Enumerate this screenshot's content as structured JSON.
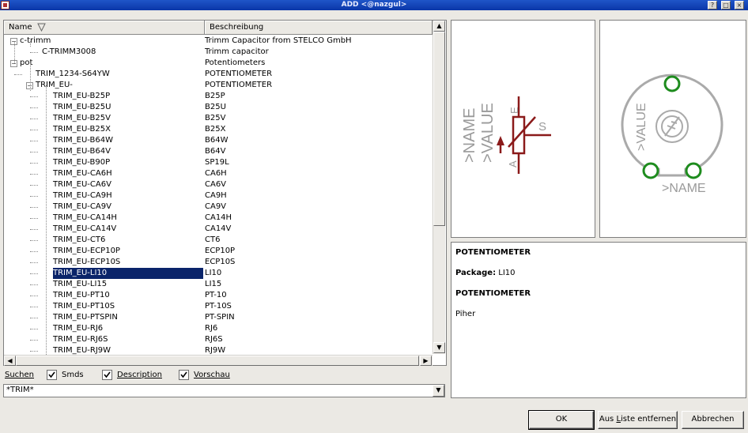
{
  "window": {
    "title": "ADD <@nazgul>"
  },
  "list": {
    "columns": [
      {
        "label": "Name"
      },
      {
        "label": "Beschreibung"
      }
    ],
    "rows": [
      {
        "name": "c-trimm",
        "desc": "Trimm Capacitor from STELCO GmbH"
      },
      {
        "name": "C-TRIMM3008",
        "desc": "Trimm capacitor"
      },
      {
        "name": "pot",
        "desc": "Potentiometers"
      },
      {
        "name": "TRIM_1234-S64YW",
        "desc": "POTENTIOMETER"
      },
      {
        "name": "TRIM_EU-",
        "desc": "POTENTIOMETER"
      },
      {
        "name": "TRIM_EU-B25P",
        "desc": "B25P"
      },
      {
        "name": "TRIM_EU-B25U",
        "desc": "B25U"
      },
      {
        "name": "TRIM_EU-B25V",
        "desc": "B25V"
      },
      {
        "name": "TRIM_EU-B25X",
        "desc": "B25X"
      },
      {
        "name": "TRIM_EU-B64W",
        "desc": "B64W"
      },
      {
        "name": "TRIM_EU-B64V",
        "desc": "B64V"
      },
      {
        "name": "TRIM_EU-B90P",
        "desc": "SP19L"
      },
      {
        "name": "TRIM_EU-CA6H",
        "desc": "CA6H"
      },
      {
        "name": "TRIM_EU-CA6V",
        "desc": "CA6V"
      },
      {
        "name": "TRIM_EU-CA9H",
        "desc": "CA9H"
      },
      {
        "name": "TRIM_EU-CA9V",
        "desc": "CA9V"
      },
      {
        "name": "TRIM_EU-CA14H",
        "desc": "CA14H"
      },
      {
        "name": "TRIM_EU-CA14V",
        "desc": "CA14V"
      },
      {
        "name": "TRIM_EU-CT6",
        "desc": "CT6"
      },
      {
        "name": "TRIM_EU-ECP10P",
        "desc": "ECP10P"
      },
      {
        "name": "TRIM_EU-ECP10S",
        "desc": "ECP10S"
      },
      {
        "name": "TRIM_EU-LI10",
        "desc": "LI10"
      },
      {
        "name": "TRIM_EU-LI15",
        "desc": "LI15"
      },
      {
        "name": "TRIM_EU-PT10",
        "desc": "PT-10"
      },
      {
        "name": "TRIM_EU-PT10S",
        "desc": "PT-10S"
      },
      {
        "name": "TRIM_EU-PTSPIN",
        "desc": "PT-SPIN"
      },
      {
        "name": "TRIM_EU-RJ6",
        "desc": "RJ6"
      },
      {
        "name": "TRIM_EU-RJ6S",
        "desc": "RJ6S"
      },
      {
        "name": "TRIM_EU-RJ9W",
        "desc": "RJ9W"
      }
    ],
    "selected_name": "TRIM_EU-LI10"
  },
  "search": {
    "label": "Suchen",
    "options": [
      {
        "label": "Smds",
        "checked": true
      },
      {
        "label": "Description",
        "checked": true
      },
      {
        "label": "Vorschau",
        "checked": true
      }
    ],
    "value": "*TRIM*"
  },
  "symbol_preview": {
    "name_label": ">NAME",
    "value_label": ">VALUE",
    "pin_e": "E",
    "pin_a": "A",
    "pin_s": "S"
  },
  "package_preview": {
    "name_label": ">NAME",
    "value_label": ">VALUE"
  },
  "description": {
    "heading": "POTENTIOMETER",
    "package_label": "Package:",
    "package_value": "LI10",
    "device_heading": "POTENTIOMETER",
    "vendor": "Piher"
  },
  "buttons": {
    "ok": "OK",
    "remove_prefix": "Aus ",
    "remove_underlined": "L",
    "remove_suffix": "iste entfernen",
    "cancel": "Abbrechen"
  },
  "colors": {
    "titlebar": "#0a36a8",
    "selection": "#0a246a",
    "symbol": "#8b1a1a",
    "pad": "#1e8c1e",
    "package_text": "#9a9a9a"
  }
}
